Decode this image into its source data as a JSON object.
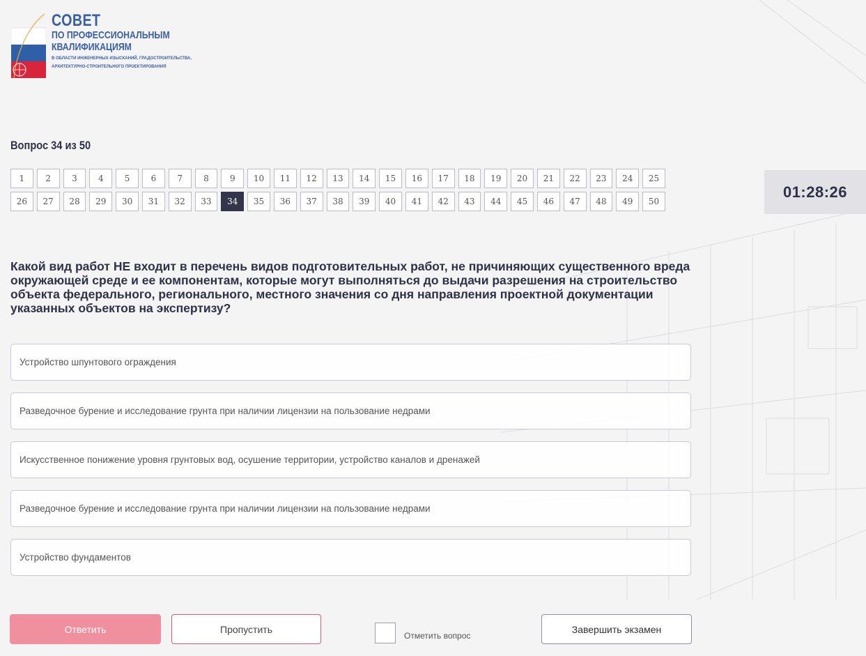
{
  "logo": {
    "title": "СОВЕТ",
    "line1": "ПО ПРОФЕССИОНАЛЬНЫМ",
    "line2": "КВАЛИФИКАЦИЯМ",
    "small1": "В ОБЛАСТИ ИНЖЕНЕРНЫХ ИЗЫСКАНИЙ, ГРАДОСТРОИТЕЛЬСТВА,",
    "small2": "АРХИТЕКТУРНО-СТРОИТЕЛЬНОГО ПРОЕКТИРОВАНИЯ"
  },
  "question_counter": "Вопрос 34 из 50",
  "questions": {
    "current": 34,
    "row1": [
      "1",
      "2",
      "3",
      "4",
      "5",
      "6",
      "7",
      "8",
      "9",
      "10",
      "11",
      "12",
      "13",
      "14",
      "15",
      "16",
      "17",
      "18",
      "19",
      "20",
      "21",
      "22",
      "23",
      "24",
      "25"
    ],
    "row2": [
      "26",
      "27",
      "28",
      "29",
      "30",
      "31",
      "32",
      "33",
      "34",
      "35",
      "36",
      "37",
      "38",
      "39",
      "40",
      "41",
      "42",
      "43",
      "44",
      "45",
      "46",
      "47",
      "48",
      "49",
      "50"
    ]
  },
  "timer": "01:28:26",
  "question_text": "Какой вид работ НЕ входит в перечень видов подготовительных работ, не причиняющих существенного вреда окружающей среде и ее компонентам, которые могут выполняться до выдачи разрешения на строительство объекта федерального, регионального, местного значения со дня направления проектной документации указанных объектов на экспертизу?",
  "answers": [
    "Устройство шпунтового ограждения",
    "Разведочное бурение и исследование грунта при наличии лицензии на пользование недрами",
    "Искусственное понижение уровня грунтовых вод, осушение территории, устройство каналов и дренажей",
    "Разведочное бурение и исследование грунта при наличии лицензии на пользование недрами",
    "Устройство фундаментов"
  ],
  "buttons": {
    "answer": "Ответить",
    "skip": "Пропустить",
    "mark": "Отметить вопрос",
    "finish": "Завершить экзамен"
  },
  "colors": {
    "brand_blue": "#3a5fa6",
    "current_cell": "#33354a",
    "answer_button": "#f0909f",
    "skip_border": "#d65c6e"
  }
}
